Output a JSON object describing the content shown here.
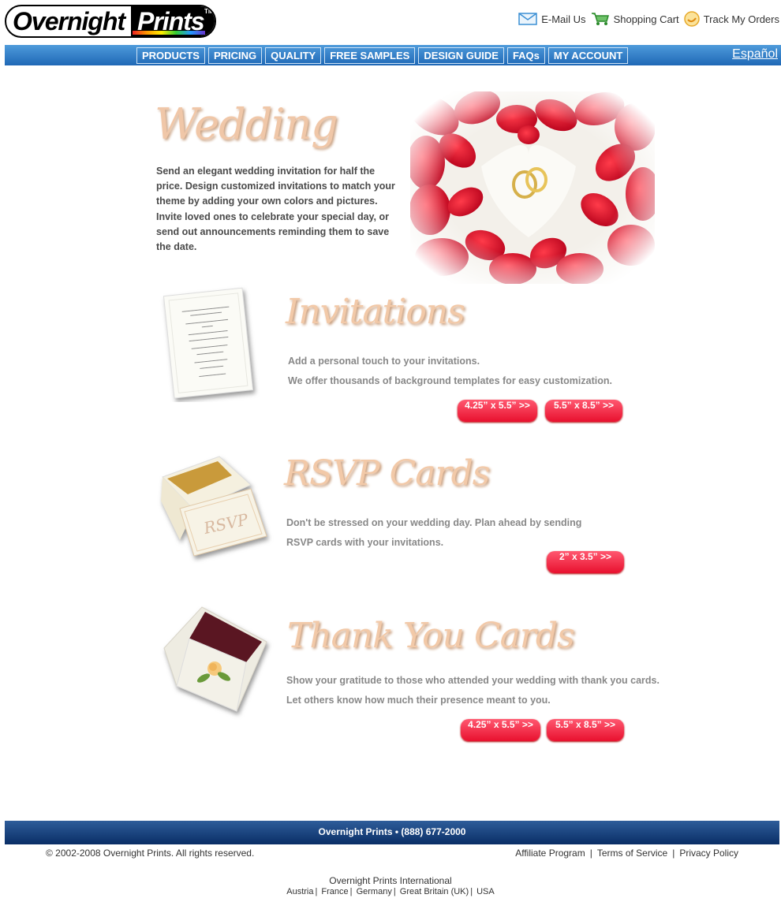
{
  "logo": {
    "part1": "Overnight",
    "part2": "Prints",
    "tm": "TM"
  },
  "header_links": [
    {
      "label": "E-Mail Us",
      "icon": "envelope-icon"
    },
    {
      "label": "Shopping Cart",
      "icon": "cart-icon"
    },
    {
      "label": "Track My Orders",
      "icon": "track-icon"
    }
  ],
  "nav": {
    "items": [
      "PRODUCTS",
      "PRICING",
      "QUALITY",
      "FREE SAMPLES",
      "DESIGN GUIDE",
      "FAQs",
      "MY ACCOUNT"
    ],
    "language_link": "Español"
  },
  "wedding": {
    "title": "Wedding",
    "description": "Send an elegant wedding invitation for half the price. Design customized invitations to match your theme by adding your own colors and pictures. Invite loved ones to celebrate your special day, or send out announcements reminding them to save the date."
  },
  "sections": [
    {
      "title": "Invitations",
      "lines": [
        "Add a personal touch to your invitations.",
        "We offer thousands of background templates for easy customization."
      ],
      "buttons": [
        "4.25” x 5.5” >>",
        "5.5” x 8.5” >>"
      ]
    },
    {
      "title": "RSVP Cards",
      "lines": [
        "Don't be stressed on your wedding day.  Plan ahead by sending",
        "RSVP cards with your invitations."
      ],
      "buttons": [
        "2” x 3.5” >>"
      ]
    },
    {
      "title": "Thank You Cards",
      "lines": [
        "Show your gratitude to those who attended your wedding with thank you cards.",
        "Let others know how much their presence meant to you."
      ],
      "buttons": [
        "4.25” x 5.5” >>",
        "5.5” x 8.5” >>"
      ]
    }
  ],
  "footer": {
    "bar": "Overnight Prints • (888) 677-2000",
    "copyright": "© 2002-2008 Overnight Prints. All rights reserved.",
    "links": [
      "Affiliate Program",
      "Terms of Service",
      "Privacy Policy"
    ],
    "intl_title": "Overnight Prints International",
    "intl_links": [
      "Austria",
      "France",
      "Germany",
      "Great Britain (UK)",
      "USA"
    ]
  },
  "colors": {
    "nav_blue": "#1f68b6",
    "button_red": "#e8102e",
    "title_peach": "#f2c9a8",
    "footer_navy": "#0a2e66"
  }
}
